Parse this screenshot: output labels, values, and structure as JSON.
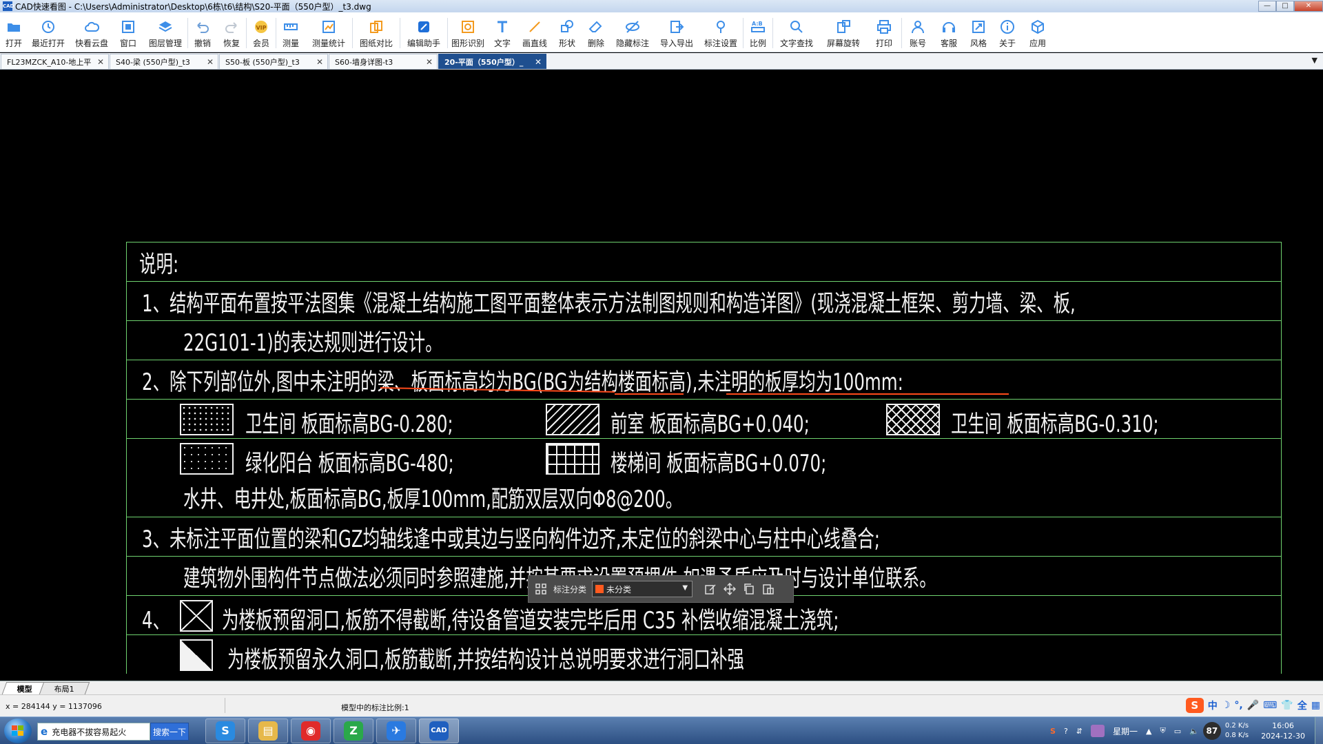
{
  "window": {
    "title": "CAD快速看图 - C:\\Users\\Administrator\\Desktop\\6栋\\t6\\结构\\S20-平面（550户型）_t3.dwg",
    "min": "—",
    "max": "□",
    "close": "✕"
  },
  "toolbar": [
    {
      "label": "打开",
      "icon": "folder-open-icon"
    },
    {
      "label": "最近打开",
      "icon": "recent-icon"
    },
    {
      "label": "快看云盘",
      "icon": "cloud-icon"
    },
    {
      "label": "窗口",
      "icon": "window-icon"
    },
    {
      "label": "图层管理",
      "icon": "layers-icon"
    },
    {
      "label": "撤销",
      "icon": "undo-icon"
    },
    {
      "label": "恢复",
      "icon": "redo-icon"
    },
    {
      "label": "会员",
      "icon": "vip-icon"
    },
    {
      "label": "测量",
      "icon": "measure-icon"
    },
    {
      "label": "测量统计",
      "icon": "measure-stats-icon"
    },
    {
      "label": "图纸对比",
      "icon": "compare-icon"
    },
    {
      "label": "编辑助手",
      "icon": "edit-assistant-icon"
    },
    {
      "label": "图形识别",
      "icon": "shape-recognition-icon"
    },
    {
      "label": "文字",
      "icon": "text-icon"
    },
    {
      "label": "画直线",
      "icon": "line-icon"
    },
    {
      "label": "形状",
      "icon": "shape-icon"
    },
    {
      "label": "删除",
      "icon": "eraser-icon"
    },
    {
      "label": "隐藏标注",
      "icon": "hide-annotation-icon"
    },
    {
      "label": "导入导出",
      "icon": "import-export-icon"
    },
    {
      "label": "标注设置",
      "icon": "annotation-settings-icon"
    },
    {
      "label": "比例",
      "icon": "scale-icon"
    },
    {
      "label": "文字查找",
      "icon": "text-search-icon"
    },
    {
      "label": "屏幕旋转",
      "icon": "rotate-screen-icon"
    },
    {
      "label": "打印",
      "icon": "print-icon"
    },
    {
      "label": "账号",
      "icon": "account-icon"
    },
    {
      "label": "客服",
      "icon": "headset-icon"
    },
    {
      "label": "风格",
      "icon": "style-icon"
    },
    {
      "label": "关于",
      "icon": "info-icon"
    },
    {
      "label": "应用",
      "icon": "apps-icon"
    }
  ],
  "tabs": [
    {
      "label": "FL23MZCK_A10-地上平...",
      "active": false
    },
    {
      "label": "S40-梁 (550户型)_t3",
      "active": false
    },
    {
      "label": "S50-板 (550户型)_t3",
      "active": false
    },
    {
      "label": "S60-墙身详图-t3",
      "active": false
    },
    {
      "label": "20-平面（550户型）_",
      "active": true
    }
  ],
  "tab_close": "✕",
  "tabs_more": "▼",
  "notes": {
    "title": "说明:",
    "line1": "1、结构平面布置按平法图集《混凝土结构施工图平面整体表示方法制图规则和构造详图》(现浇混凝土框架、剪力墙、梁、板,",
    "line1b": "22G101-1)的表达规则进行设计。",
    "line2": "2、除下列部位外,图中未注明的梁、板面标高均为BG(BG为结构楼面标高),未注明的板厚均为100mm:",
    "legend": [
      {
        "label": "卫生间  板面标高BG-0.280;",
        "pattern": "dots"
      },
      {
        "label": "前室  板面标高BG+0.040;",
        "pattern": "diagonal"
      },
      {
        "label": "卫生间  板面标高BG-0.310;",
        "pattern": "crosshatch"
      },
      {
        "label": "绿化阳台  板面标高BG-480;",
        "pattern": "sparse-dots"
      },
      {
        "label": "楼梯间  板面标高BG+0.070;",
        "pattern": "grid"
      }
    ],
    "line2c": "水井、电井处,板面标高BG,板厚100mm,配筋双层双向Φ8@200。",
    "line3": "3、未标注平面位置的梁和GZ均轴线逢中或其边与竖向构件边齐,未定位的斜梁中心与柱中心线叠合;",
    "line3b": "建筑物外围构件节点做法必须同时参照建施,并按其要求设置预埋件,如遇矛盾应及时与设计单位联系。",
    "line4_num": "4、",
    "line4": "为楼板预留洞口,板筋不得截断,待设备管道安装完毕后用 C35 补偿收缩混凝土浇筑;",
    "line4b": "为楼板预留永久洞口,板筋截断,并按结构设计总说明要求进行洞口补强"
  },
  "annotation_bar": {
    "label": "标注分类",
    "selected": "未分类",
    "color": "#ff5a1f"
  },
  "layout_tabs": [
    {
      "label": "模型",
      "active": true
    },
    {
      "label": "布局1",
      "active": false
    }
  ],
  "status": {
    "coords": "x = 284144  y = 1137096",
    "scale": "模型中的标注比例:1"
  },
  "ime": [
    "中",
    "☽",
    "°,",
    "🎤",
    "⌨",
    "👕",
    "全",
    "▦"
  ],
  "taskbar": {
    "search_text": "充电器不拔容易起火",
    "search_button": "搜索一下",
    "apps": [
      {
        "name": "sogou-browser",
        "glyph": "S",
        "color": "#2a8ae0"
      },
      {
        "name": "file-explorer",
        "glyph": "▤",
        "color": "#e6b84a"
      },
      {
        "name": "netease-music",
        "glyph": "◉",
        "color": "#e02a2a"
      },
      {
        "name": "green-app",
        "glyph": "Z",
        "color": "#2aa84a"
      },
      {
        "name": "feishu-app",
        "glyph": "✈",
        "color": "#2a7ae0"
      },
      {
        "name": "cad-viewer",
        "glyph": "CAD",
        "color": "#1f5fbf"
      }
    ],
    "weekday": "星期一",
    "temp": "87",
    "net_up": "0.2 K/s",
    "net_down": "0.8 K/s",
    "time": "16:06",
    "date": "2024-12-30"
  },
  "colors": {
    "grid_line": "#6fd36f",
    "text": "#f2f2f2",
    "markup": "#ff4a1a",
    "active_tab": "#1f4f8f"
  }
}
